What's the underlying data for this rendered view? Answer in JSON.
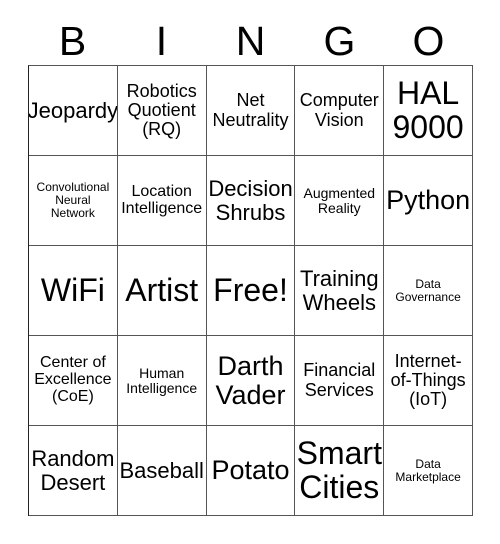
{
  "card": {
    "header_letters": [
      "B",
      "I",
      "N",
      "G",
      "O"
    ],
    "grid": {
      "columns": 5,
      "rows": 5,
      "cells": [
        {
          "text": "Jeopardy",
          "size": "lg"
        },
        {
          "text": "Robotics\nQuotient\n(RQ)",
          "size": "md"
        },
        {
          "text": "Net\nNeutrality",
          "size": "md"
        },
        {
          "text": "Computer\nVision",
          "size": "md"
        },
        {
          "text": "HAL\n9000",
          "size": "xxl"
        },
        {
          "text": "Convolutional\nNeural\nNetwork",
          "size": "xxs"
        },
        {
          "text": "Location\nIntelligence",
          "size": "sm"
        },
        {
          "text": "Decision\nShrubs",
          "size": "lg"
        },
        {
          "text": "Augmented\nReality",
          "size": "xs"
        },
        {
          "text": "Python",
          "size": "xl"
        },
        {
          "text": "WiFi",
          "size": "xxl"
        },
        {
          "text": "Artist",
          "size": "xxl"
        },
        {
          "text": "Free!",
          "size": "xxl"
        },
        {
          "text": "Training\nWheels",
          "size": "lg"
        },
        {
          "text": "Data\nGovernance",
          "size": "xxs"
        },
        {
          "text": "Center of\nExcellence\n(CoE)",
          "size": "sm"
        },
        {
          "text": "Human\nIntelligence",
          "size": "xs"
        },
        {
          "text": "Darth\nVader",
          "size": "xl"
        },
        {
          "text": "Financial\nServices",
          "size": "md"
        },
        {
          "text": "Internet-\nof-Things\n(IoT)",
          "size": "md"
        },
        {
          "text": "Random\nDesert",
          "size": "lg"
        },
        {
          "text": "Baseball",
          "size": "lg"
        },
        {
          "text": "Potato",
          "size": "xl"
        },
        {
          "text": "Smart\nCities",
          "size": "xxl"
        },
        {
          "text": "Data\nMarketplace",
          "size": "xxs"
        }
      ]
    }
  },
  "colors": {
    "background": "#ffffff",
    "text": "#000000",
    "grid_line": "#555555"
  }
}
